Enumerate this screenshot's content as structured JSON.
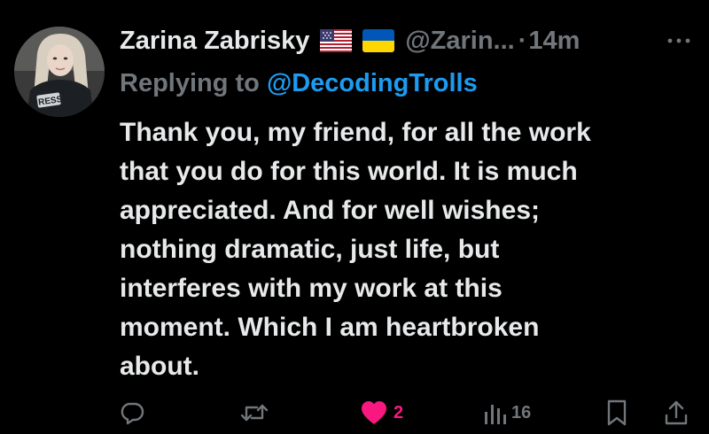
{
  "author": {
    "display_name": "Zarina Zabrisky",
    "flags": [
      "us-flag",
      "ukraine-flag"
    ],
    "handle": "@Zarin...",
    "separator": "·",
    "time": "14m",
    "avatar_text": "RESS"
  },
  "reply": {
    "prefix": "Replying to",
    "mention": "@DecodingTrolls"
  },
  "body_lines": [
    "Thank you, my friend, for all the work",
    "that you do for this world. It is much",
    "appreciated. And for well wishes;",
    "nothing dramatic, just life, but",
    "interferes with my work at this",
    "moment. Which I am heartbroken",
    "about."
  ],
  "actions": {
    "reply_icon": "reply-icon",
    "retweet_icon": "retweet-icon",
    "like_icon": "heart-filled-icon",
    "like_count": "2",
    "views_icon": "views-icon",
    "views_count": "16",
    "bookmark_icon": "bookmark-icon",
    "share_icon": "share-icon"
  },
  "more_icon": "more-dots-icon",
  "colors": {
    "background": "#000000",
    "text_primary": "#e7e9ea",
    "text_secondary": "#71767b",
    "link": "#1d9bf0",
    "like": "#f91880"
  }
}
